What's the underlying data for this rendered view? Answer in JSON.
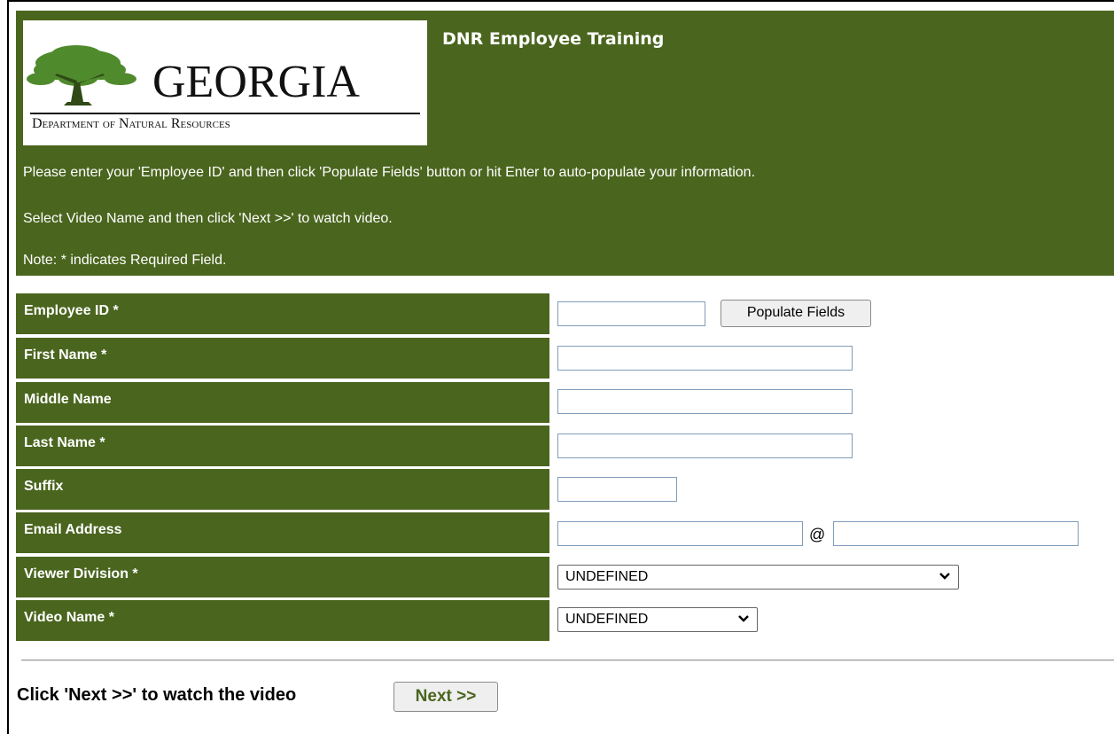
{
  "header": {
    "logo": {
      "word": "GEORGIA",
      "subtitle": "Department of Natural Resources"
    },
    "title": "DNR Employee Training",
    "instructions": [
      "Please enter your 'Employee ID' and then click 'Populate Fields' button or hit Enter to auto-populate your information.",
      "Select Video Name and then click 'Next >>' to watch video.",
      "Note: * indicates Required Field."
    ]
  },
  "form": {
    "labels": {
      "employee_id": "Employee ID *",
      "first_name": "First Name *",
      "middle_name": "Middle Name",
      "last_name": "Last Name *",
      "suffix": "Suffix",
      "email": "Email Address",
      "division": "Viewer Division *",
      "video": "Video Name *"
    },
    "values": {
      "employee_id": "",
      "first_name": "",
      "middle_name": "",
      "last_name": "",
      "suffix": "",
      "email_user": "",
      "email_domain": ""
    },
    "populate_button": "Populate Fields",
    "email_at": "@",
    "division_selected": "UNDEFINED",
    "video_selected": "UNDEFINED"
  },
  "footer": {
    "text": "Click 'Next >>' to watch the video",
    "next_button": "Next >>"
  },
  "colors": {
    "header_bg": "#4a651e",
    "tree_green": "#4f8a2c"
  }
}
